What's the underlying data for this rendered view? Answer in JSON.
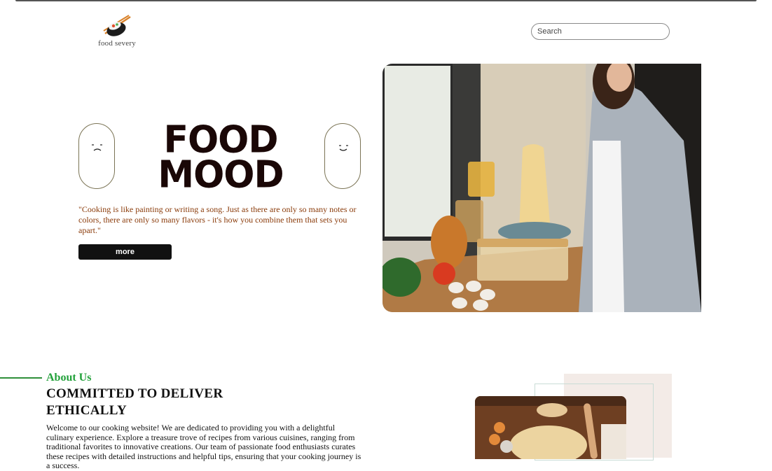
{
  "header": {
    "logo_text": "food severy",
    "search_placeholder": "Search"
  },
  "hero": {
    "title_line1": "FOOD",
    "title_line2": "MOOD",
    "quote": "\"Cooking is like painting or writing a song. Just as there are only so many notes or colors, there are only so many flavors - it's how you combine them that sets you apart.\"",
    "more_label": "more"
  },
  "about": {
    "label": "About Us",
    "title": "COMMITTED TO DELIVER ETHICALLY",
    "text": "Welcome to our cooking website! We are dedicated to providing you with a delightful culinary experience. Explore a treasure trove of recipes from various cuisines, ranging from traditional favorites to innovative creations. Our team of passionate food enthusiasts curates these recipes with detailed instructions and helpful tips, ensuring that your cooking journey is a success."
  },
  "colors": {
    "accent_green": "#22a13a",
    "quote_brown": "#8a3b0a",
    "title_dark": "#1a0706",
    "button_black": "#111111"
  }
}
